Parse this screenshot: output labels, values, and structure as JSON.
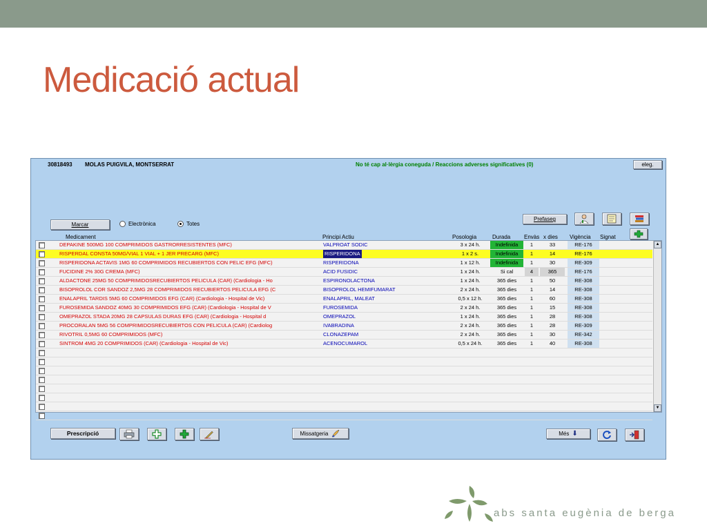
{
  "slide": {
    "title": "Medicació actual"
  },
  "patient": {
    "id": "30818493",
    "name": "MOLAS PUIGVILA, MONTSERRAT",
    "allergy_notice": "No té cap al·lèrgia coneguda / Reaccions adverses significatives (0)"
  },
  "toolbar": {
    "eleg_label": "eleg.",
    "marcar_label": "Marcar",
    "prefaseg_label": "Prefaseg",
    "filter_options": [
      {
        "label": "Electrònica",
        "selected": false
      },
      {
        "label": "Totes",
        "selected": true
      }
    ]
  },
  "table": {
    "headers": [
      "Medicament",
      "Principi Actiu",
      "Posologia",
      "Durada",
      "Envàs",
      "x dies",
      "Vigència",
      "Signat"
    ],
    "rows": [
      {
        "med": "DEPAKINE 500MG 100 COMPRIMIDOS GASTRORRESISTENTES  (MFC)",
        "principi": "VALPROAT SODIC",
        "posologia": "3 x 24 h.",
        "durada": "Indefinida",
        "envas": "1",
        "dies": "33",
        "vigencia": "RE-176",
        "selected": false,
        "durada_green": true
      },
      {
        "med": "RISPERDAL CONSTA 50MG/VIAL 1 VIAL + 1 JER PRECARG  (MFC)",
        "principi": "RISPERIDONA",
        "posologia": "1 x 2 s.",
        "durada": "Indefinida",
        "envas": "1",
        "dies": "14",
        "vigencia": "RE-176",
        "selected": true,
        "durada_green": true
      },
      {
        "med": "RISPERIDONA ACTAVIS 1MG 60 COMPRIMIDOS RECUBIERTOS CON PELIC EFG  (MFC)",
        "principi": "RISPERIDONA",
        "posologia": "1 x 12 h.",
        "durada": "Indefinida",
        "envas": "1",
        "dies": "30",
        "vigencia": "RE-309",
        "selected": false,
        "durada_green": true
      },
      {
        "med": "FUCIDINE 2% 30G CREMA  (MFC)",
        "principi": "ACID FUSIDIC",
        "posologia": "1 x 24 h.",
        "durada": "Si cal",
        "envas": "4",
        "dies": "365",
        "vigencia": "RE-176",
        "selected": false,
        "durada_green": false,
        "grey": true
      },
      {
        "med": "ALDACTONE 25MG 50 COMPRIMIDOSRECUBIERTOS PELICULA  (CAR) (Cardiologia - Ho",
        "principi": "ESPIRONOLACTONA",
        "posologia": "1 x 24 h.",
        "durada": "365 dies",
        "envas": "1",
        "dies": "50",
        "vigencia": "RE-308",
        "selected": false,
        "durada_green": false
      },
      {
        "med": "BISOPROLOL COR SANDOZ 2,5MG 28 COMPRIMIDOS RECUBIERTOS PELICULA EFG  (C",
        "principi": "BISOPROLOL HEMIFUMARAT",
        "posologia": "2 x 24 h.",
        "durada": "365 dies",
        "envas": "1",
        "dies": "14",
        "vigencia": "RE-308",
        "selected": false,
        "durada_green": false
      },
      {
        "med": "ENALAPRIL TARDIS 5MG 60 COMPRIMIDOS EFG  (CAR) (Cardiologia - Hospital de Vic)",
        "principi": "ENALAPRIL, MALEAT",
        "posologia": "0,5 x 12 h.",
        "durada": "365 dies",
        "envas": "1",
        "dies": "60",
        "vigencia": "RE-308",
        "selected": false,
        "durada_green": false
      },
      {
        "med": "FUROSEMIDA SANDOZ 40MG 30 COMPRIMIDOS EFG  (CAR) (Cardiologia - Hospital de V",
        "principi": "FUROSEMIDA",
        "posologia": "2 x 24 h.",
        "durada": "365 dies",
        "envas": "1",
        "dies": "15",
        "vigencia": "RE-308",
        "selected": false,
        "durada_green": false
      },
      {
        "med": "OMEPRAZOL STADA 20MG 28 CAPSULAS DURAS EFG  (CAR) (Cardiologia - Hospital d",
        "principi": "OMEPRAZOL",
        "posologia": "1 x 24 h.",
        "durada": "365 dies",
        "envas": "1",
        "dies": "28",
        "vigencia": "RE-308",
        "selected": false,
        "durada_green": false
      },
      {
        "med": "PROCORALAN 5MG 56 COMPRIMIDOSRECUBIERTOS CON PELICULA  (CAR) (Cardiolog",
        "principi": "IVABRADINA",
        "posologia": "2 x 24 h.",
        "durada": "365 dies",
        "envas": "1",
        "dies": "28",
        "vigencia": "RE-309",
        "selected": false,
        "durada_green": false
      },
      {
        "med": "RIVOTRIL 0,5MG 60 COMPRIMIDOS  (MFC)",
        "principi": "CLONAZEPAM",
        "posologia": "2 x 24 h.",
        "durada": "365 dies",
        "envas": "1",
        "dies": "30",
        "vigencia": "RE-342",
        "selected": false,
        "durada_green": false
      },
      {
        "med": "SINTROM 4MG 20 COMPRIMIDOS  (CAR) (Cardiologia - Hospital de Vic)",
        "principi": "ACENOCUMAROL",
        "posologia": "0,5 x 24 h.",
        "durada": "365 dies",
        "envas": "1",
        "dies": "40",
        "vigencia": "RE-308",
        "selected": false,
        "durada_green": false
      }
    ],
    "empty_rows": 8
  },
  "bottom": {
    "prescripcio_label": "Prescripció",
    "missatgeria_label": "Missatgeria",
    "mes_label": "Més"
  },
  "footer": {
    "brand_text": "abs santa eugènia de berga"
  },
  "colors": {
    "title": "#cc5a3e",
    "top_band": "#8a9a8b",
    "window_bg": "#b2d1ee",
    "med_text": "#d40000",
    "principi_text": "#0000b4",
    "selected_row": "#fdfd22",
    "durada_green": "#22b436",
    "allergy_text": "#008000"
  }
}
